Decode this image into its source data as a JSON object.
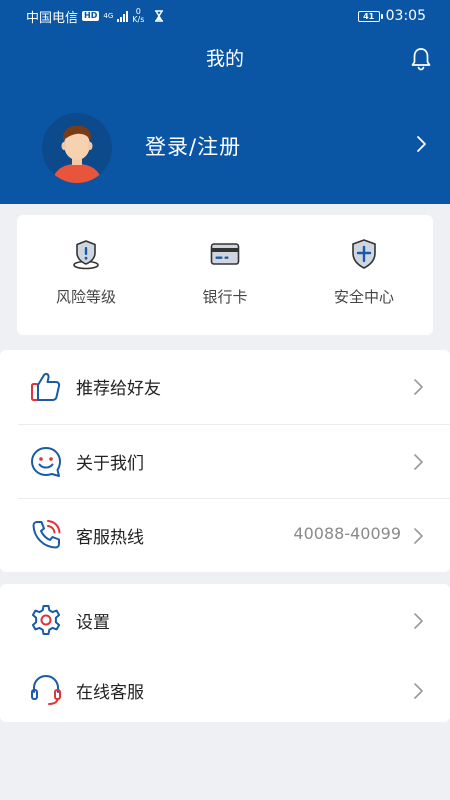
{
  "status_bar": {
    "carrier": "中国电信",
    "hd": "HD",
    "network": "4G",
    "speed_value": "0",
    "speed_unit": "K/s",
    "battery": "41",
    "time": "03:05"
  },
  "header": {
    "title": "我的",
    "login_label": "登录/注册"
  },
  "quick_actions": [
    {
      "label": "风险等级",
      "icon": "risk-level-icon"
    },
    {
      "label": "银行卡",
      "icon": "bank-card-icon"
    },
    {
      "label": "安全中心",
      "icon": "security-shield-icon"
    }
  ],
  "menu_group_1": [
    {
      "label": "推荐给好友",
      "icon": "thumbs-up-icon",
      "value": ""
    },
    {
      "label": "关于我们",
      "icon": "smile-chat-icon",
      "value": ""
    },
    {
      "label": "客服热线",
      "icon": "phone-icon",
      "value": "40088-40099"
    }
  ],
  "menu_group_2": [
    {
      "label": "设置",
      "icon": "gear-icon",
      "value": ""
    },
    {
      "label": "在线客服",
      "icon": "headset-icon",
      "value": ""
    }
  ],
  "colors": {
    "brand_blue": "#0a56a4",
    "icon_blue": "#1b5aa6",
    "icon_red": "#e0333a",
    "background": "#eef0f4"
  }
}
